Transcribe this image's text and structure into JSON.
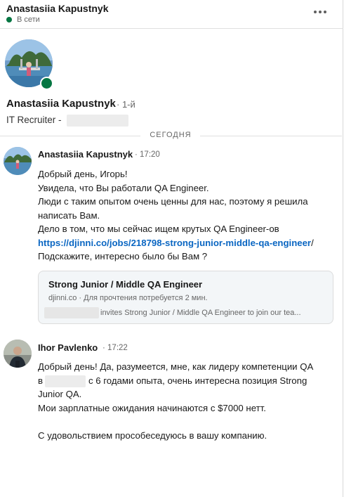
{
  "header": {
    "name": "Anastasiia Kapustnyk",
    "status": "В сети"
  },
  "profile": {
    "name": "Anastasiia Kapustnyk",
    "degree": "· 1-й",
    "title": "IT Recruiter -"
  },
  "divider": {
    "label": "СЕГОДНЯ"
  },
  "messages": [
    {
      "sender": "Anastasiia Kapustnyk",
      "time": "· 17:20",
      "lines": [
        "Добрый день, Игорь!",
        "Увидела, что Вы работали QA Engineer.",
        "Люди с таким опытом очень ценны для нас, поэтому я решила",
        "написать Вам.",
        "Дело в том, что мы сейчас ищем крутых QA Engineer-ов"
      ],
      "link": "https://djinni.co/jobs/218798-strong-junior-middle-qa-engineer",
      "link_suffix": "/",
      "after_link": "Подскажите, интересно было бы Вам ?",
      "card": {
        "title": "Strong Junior / Middle QA Engineer",
        "domain": "djinni.co",
        "read_time": "· Для прочтения потребуется 2 мин.",
        "invite": "invites Strong Junior / Middle QA Engineer to join our tea..."
      }
    },
    {
      "sender": "Ihor Pavlenko",
      "time": "· 17:22",
      "line1": "Добрый день! Да, разумеется, мне, как лидеру компетенции QA",
      "line2_prefix": "в",
      "line2_suffix": "с 6 годами опыта, очень интересна позиция Strong",
      "line3": "Junior QA.",
      "line4": "Мои зарплатные ожидания начинаются с $7000 нетт.",
      "line5": "С удовольствием прособеседуюсь в вашу компанию."
    }
  ],
  "colors": {
    "online": "#057642",
    "link": "#0a66c2",
    "card_bg": "#f3f6f8"
  },
  "icons": {
    "more": "more-options-icon",
    "status": "online-status-dot"
  }
}
